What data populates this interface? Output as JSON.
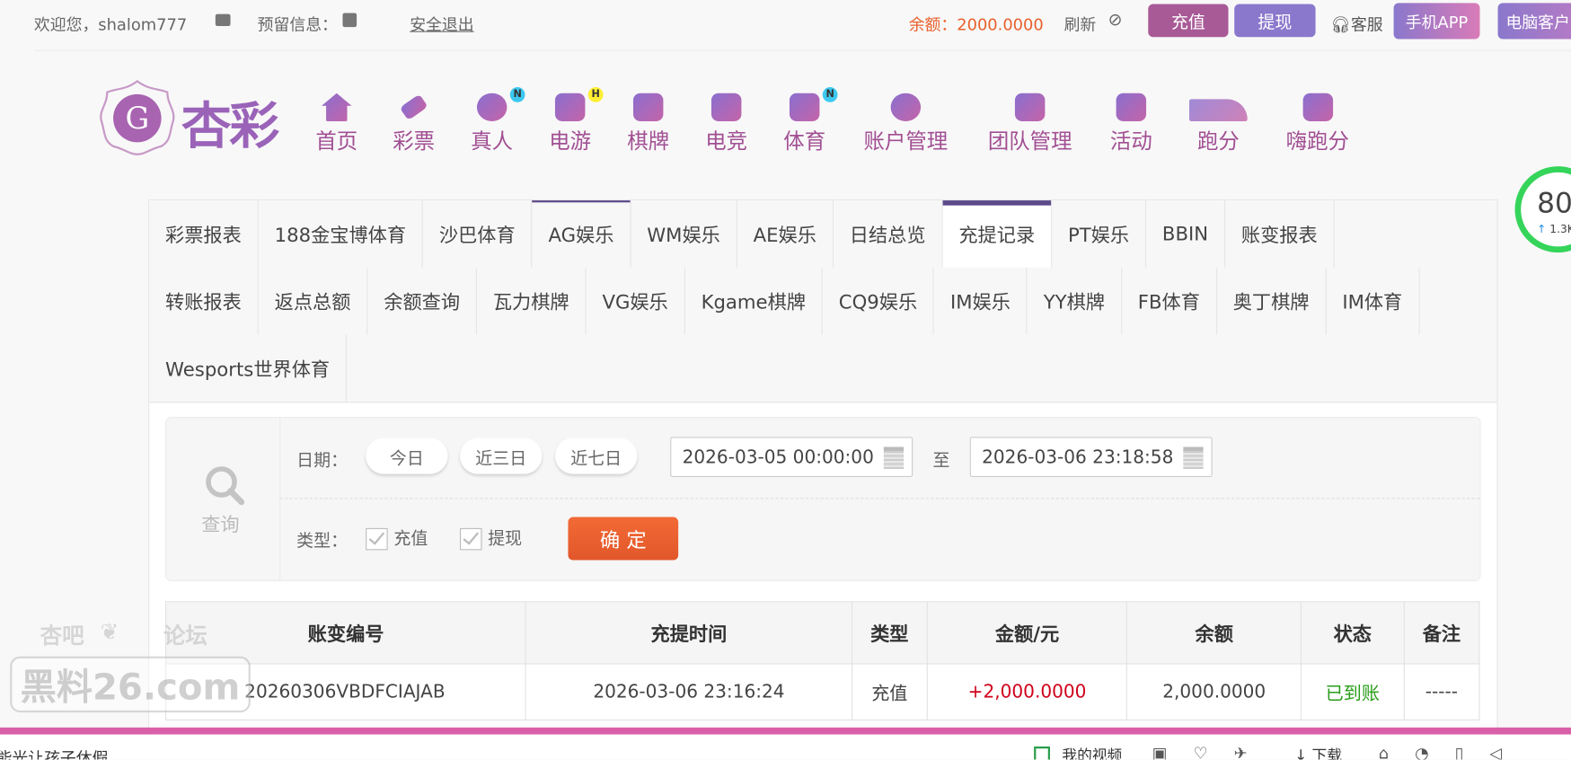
{
  "topbar": {
    "welcome": "欢迎您，shalom777",
    "reserved_info": "预留信息：",
    "logout": "安全退出",
    "balance": "余额：2000.0000",
    "refresh": "刷新",
    "deposit": "充值",
    "withdraw": "提现",
    "service": "客服",
    "mobile_app": "手机APP",
    "pc_client": "电脑客户"
  },
  "logo": {
    "text": "杏彩"
  },
  "nav": [
    {
      "label": "首页",
      "icon": "home-icon"
    },
    {
      "label": "彩票",
      "icon": "lottery-icon"
    },
    {
      "label": "真人",
      "icon": "live-dealer-icon",
      "badge": "N"
    },
    {
      "label": "电游",
      "icon": "gamepad-icon",
      "badge": "H"
    },
    {
      "label": "棋牌",
      "icon": "cards-icon"
    },
    {
      "label": "电竞",
      "icon": "esports-icon"
    },
    {
      "label": "体育",
      "icon": "trophy-icon",
      "badge": "N"
    },
    {
      "label": "账户管理",
      "icon": "yen-coin-icon"
    },
    {
      "label": "团队管理",
      "icon": "team-icon"
    },
    {
      "label": "活动",
      "icon": "gift-icon"
    },
    {
      "label": "跑分",
      "icon": "rhino-icon"
    },
    {
      "label": "嗨跑分",
      "icon": "hi-icon"
    }
  ],
  "tabs": [
    "彩票报表",
    "188金宝博体育",
    "沙巴体育",
    "AG娱乐",
    "WM娱乐",
    "AE娱乐",
    "日结总览",
    "充提记录",
    "PT娱乐",
    "BBIN",
    "账变报表",
    "转账报表",
    "返点总额",
    "余额查询",
    "瓦力棋牌",
    "VG娱乐",
    "Kgame棋牌",
    "CQ9娱乐",
    "IM娱乐",
    "YY棋牌",
    "FB体育",
    "奥丁棋牌",
    "IM体育",
    "Wesports世界体育"
  ],
  "active_tab": "充提记录",
  "filter": {
    "search_label": "查询",
    "date_label": "日期：",
    "today": "今日",
    "three_days": "近三日",
    "seven_days": "近七日",
    "start": "2026-03-05 00:00:00",
    "to": "至",
    "end": "2026-03-06 23:18:58",
    "type_label": "类型：",
    "deposit": "充值",
    "withdraw": "提现",
    "confirm": "确 定"
  },
  "table": {
    "headers": [
      "账变编号",
      "充提时间",
      "类型",
      "金额/元",
      "余额",
      "状态",
      "备注"
    ],
    "rows": [
      [
        "20260306VBDFCIAJAB",
        "2026-03-06 23:16:24",
        "充值",
        "+2,000.0000",
        "2,000.0000",
        "已到账",
        "-----"
      ]
    ]
  },
  "gauge": {
    "value": "80",
    "sub": "1.3K"
  },
  "watermark": {
    "line1": "杏吧",
    "line2": "论坛",
    "site": "黑料26.com"
  },
  "bottom": {
    "left_text": "能光让孩子休假",
    "my_video": "我的视频",
    "download": "下载"
  },
  "colors": {
    "accent": "#a14f93",
    "orange": "#e8602c",
    "pink_bar": "#d95fa8"
  }
}
